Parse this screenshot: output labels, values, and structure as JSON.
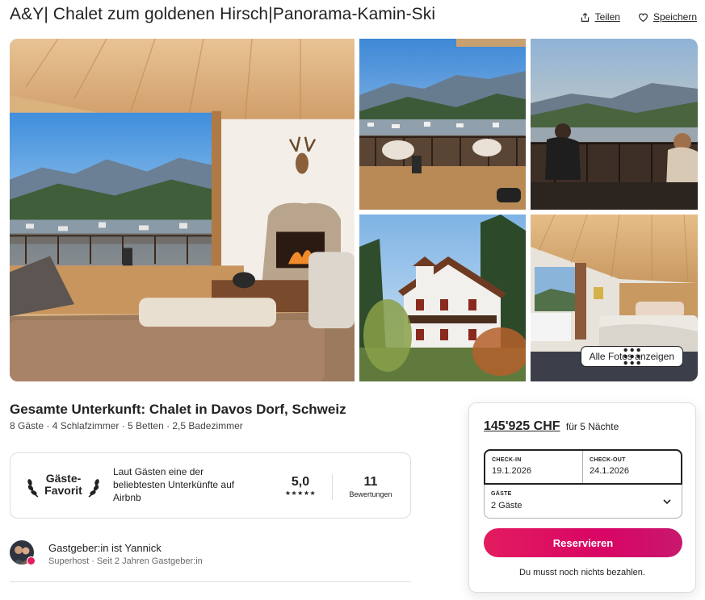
{
  "header": {
    "title": "A&Y| Chalet zum goldenen Hirsch|Panorama-Kamin-Ski",
    "share_label": "Teilen",
    "save_label": "Speichern",
    "share_icon": "share-icon",
    "save_icon": "heart-icon"
  },
  "gallery": {
    "show_all_label": "Alle Fotos anzeigen",
    "show_all_icon": "grid-icon"
  },
  "listing": {
    "title": "Gesamte Unterkunft: Chalet in Davos Dorf, Schweiz",
    "summary": "8 Gäste · 4 Schlafzimmer · 5 Betten · 2,5 Badezimmer"
  },
  "guest_favorite": {
    "badge_line1": "Gäste-",
    "badge_line2": "Favorit",
    "description": "Laut Gästen eine der beliebtesten Unterkünfte auf Airbnb",
    "rating": "5,0",
    "stars": "★★★★★",
    "reviews_count": "11",
    "reviews_label": "Bewertungen"
  },
  "host": {
    "name_line": "Gastgeber:in ist Yannick",
    "sub_line": "Superhost · Seit 2 Jahren Gastgeber:in"
  },
  "booking": {
    "price": "145'925 CHF",
    "price_suffix": "für 5 Nächte",
    "checkin_label": "CHECK-IN",
    "checkin_value": "19.1.2026",
    "checkout_label": "CHECK-OUT",
    "checkout_value": "24.1.2026",
    "guests_label": "GÄSTE",
    "guests_value": "2 Gäste",
    "reserve_label": "Reservieren",
    "note": "Du musst noch nichts bezahlen."
  },
  "colors": {
    "accent": "#e31c5f",
    "text": "#222222",
    "muted": "#6a6a6a",
    "border": "#dddddd"
  }
}
